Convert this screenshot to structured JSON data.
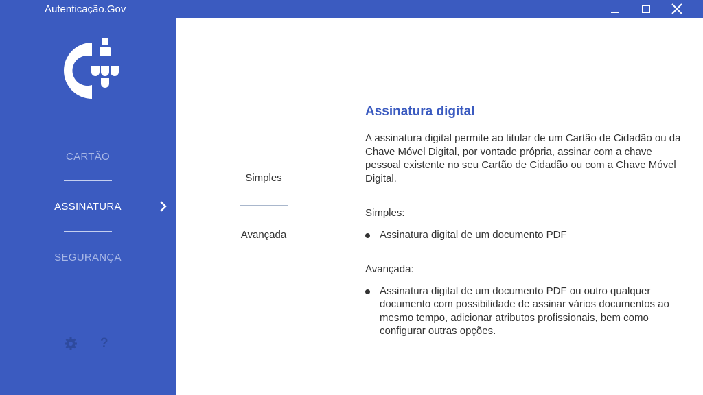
{
  "window": {
    "title": "Autenticação.Gov",
    "controls": [
      "minimize-icon",
      "maximize-icon",
      "close-icon"
    ]
  },
  "sidebar": {
    "items": [
      {
        "label": "CARTÃO",
        "active": false
      },
      {
        "label": "ASSINATURA",
        "active": true
      },
      {
        "label": "SEGURANÇA",
        "active": false
      }
    ],
    "footer_icons": [
      "gear-icon",
      "help-icon"
    ],
    "help_glyph": "?"
  },
  "submenu": {
    "items": [
      {
        "label": "Simples"
      },
      {
        "label": "Avançada"
      }
    ]
  },
  "main": {
    "title": "Assinatura digital",
    "intro": "A assinatura digital permite ao titular de um Cartão de Cidadão ou da Chave Móvel Digital, por vontade própria, assinar com a chave pessoal existente no seu Cartão de Cidadão ou com a Chave Móvel Digital.",
    "sections": [
      {
        "label": "Simples:",
        "bullets": [
          "Assinatura digital de um documento PDF"
        ]
      },
      {
        "label": "Avançada:",
        "bullets": [
          "Assinatura digital de um documento PDF ou outro qualquer documento com possibilidade de assinar vários documentos ao mesmo tempo, adicionar atributos profissionais, bem como configurar outras opções."
        ]
      }
    ]
  },
  "colors": {
    "brand_blue": "#3b5bc0",
    "inactive_nav": "#a9b8e6",
    "text": "#333333"
  }
}
